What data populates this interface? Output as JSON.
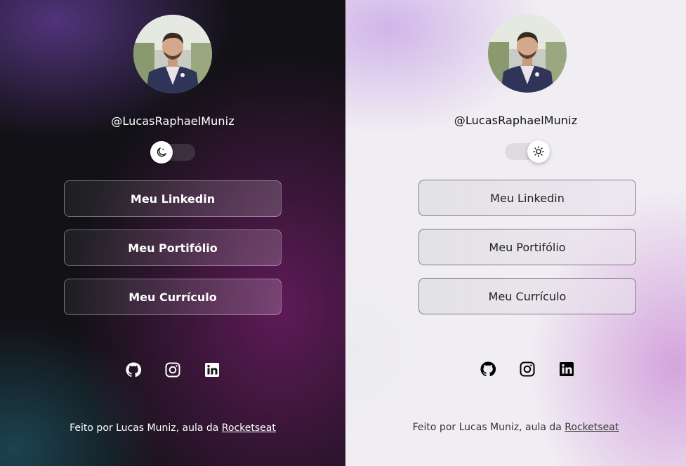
{
  "profile": {
    "handle": "@LucasRaphaelMuniz"
  },
  "links": [
    {
      "label": "Meu Linkedin"
    },
    {
      "label": "Meu Portifólio"
    },
    {
      "label": "Meu Currículo"
    }
  ],
  "social": [
    "github-icon",
    "instagram-icon",
    "linkedin-icon"
  ],
  "footer": {
    "text": "Feito por Lucas Muniz, aula da ",
    "link_label": "Rocketseat"
  },
  "themes": {
    "dark": {
      "mode": "dark",
      "toggle_icon": "moon-icon"
    },
    "light": {
      "mode": "light",
      "toggle_icon": "sun-icon"
    }
  },
  "colors": {
    "dark_bg": "#121116",
    "dark_accent": "#781e6e",
    "light_bg": "#f1eef3",
    "light_accent": "#d2a0dc"
  }
}
